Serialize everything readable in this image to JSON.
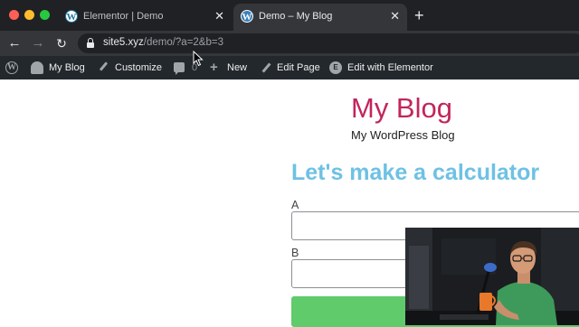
{
  "browser": {
    "tabs": [
      {
        "title": "Elementor | Demo",
        "active": false
      },
      {
        "title": "Demo – My Blog",
        "active": true
      }
    ],
    "url": {
      "host": "site5.xyz",
      "path": "/demo/?a=2&b=3"
    }
  },
  "admin_bar": {
    "site_name": "My Blog",
    "customize": "Customize",
    "comments_count": "0",
    "new": "New",
    "edit_page": "Edit Page",
    "edit_with_elementor": "Edit with Elementor"
  },
  "site": {
    "title": "My Blog",
    "tagline": "My WordPress Blog"
  },
  "page": {
    "heading": "Let's make a calculator",
    "fields": [
      {
        "label": "A",
        "value": ""
      },
      {
        "label": "B",
        "value": ""
      }
    ]
  },
  "colors": {
    "site_title": "#c2255c",
    "heading": "#6ec1e4",
    "submit_button": "#5fcb6a",
    "admin_bar": "#23282d"
  },
  "icons": {
    "tab_favicon": "wordpress-logo-icon",
    "admin_bar": [
      "wordpress-logo-icon",
      "dashboard-icon",
      "brush-icon",
      "comment-icon",
      "plus-icon",
      "pencil-icon",
      "elementor-icon"
    ]
  }
}
